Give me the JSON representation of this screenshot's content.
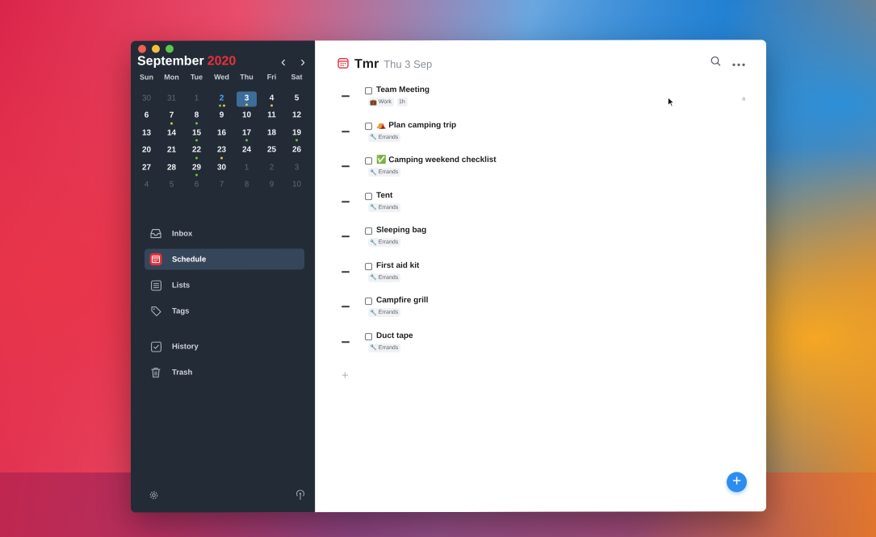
{
  "calendar": {
    "month": "September",
    "year": "2020",
    "prev_label": "‹",
    "next_label": "›",
    "weekdays": [
      "Sun",
      "Mon",
      "Tue",
      "Wed",
      "Thu",
      "Fri",
      "Sat"
    ],
    "weeks": [
      [
        "30",
        "31",
        "1",
        "2",
        "3",
        "4",
        "5"
      ],
      [
        "6",
        "7",
        "8",
        "9",
        "10",
        "11",
        "12"
      ],
      [
        "13",
        "14",
        "15",
        "16",
        "17",
        "18",
        "19"
      ],
      [
        "20",
        "21",
        "22",
        "23",
        "24",
        "25",
        "26"
      ],
      [
        "27",
        "28",
        "29",
        "30",
        "1",
        "2",
        "3"
      ],
      [
        "4",
        "5",
        "6",
        "7",
        "8",
        "9",
        "10"
      ]
    ]
  },
  "sidebar": {
    "items": [
      {
        "label": "Inbox",
        "icon": "inbox-icon"
      },
      {
        "label": "Schedule",
        "icon": "calendar-icon"
      },
      {
        "label": "Lists",
        "icon": "list-icon"
      },
      {
        "label": "Tags",
        "icon": "tag-icon"
      },
      {
        "label": "History",
        "icon": "checkbox-icon"
      },
      {
        "label": "Trash",
        "icon": "trash-icon"
      }
    ],
    "footer_icons": [
      "gear-icon",
      "antenna-icon"
    ]
  },
  "header": {
    "title": "Tmr",
    "date": "Thu 3 Sep"
  },
  "tasks": [
    {
      "name": "Team Meeting",
      "tags": [
        "Work",
        "1h"
      ],
      "right": "a"
    },
    {
      "name": "⛺ Plan camping trip",
      "tags": [
        "Errands"
      ]
    },
    {
      "name": "✅ Camping weekend checklist",
      "tags": [
        "Errands"
      ]
    },
    {
      "name": "Tent",
      "tags": [
        "Errands"
      ]
    },
    {
      "name": "Sleeping bag",
      "tags": [
        "Errands"
      ]
    },
    {
      "name": "First aid kit",
      "tags": [
        "Errands"
      ]
    },
    {
      "name": "Campfire grill",
      "tags": [
        "Errands"
      ]
    },
    {
      "name": "Duct tape",
      "tags": [
        "Errands"
      ]
    }
  ],
  "colors": {
    "sidebar_bg": "#232b36",
    "accent_red": "#e8303c",
    "accent_blue": "#2d8cf0"
  },
  "add_task_label": "+",
  "fab_label": "+"
}
